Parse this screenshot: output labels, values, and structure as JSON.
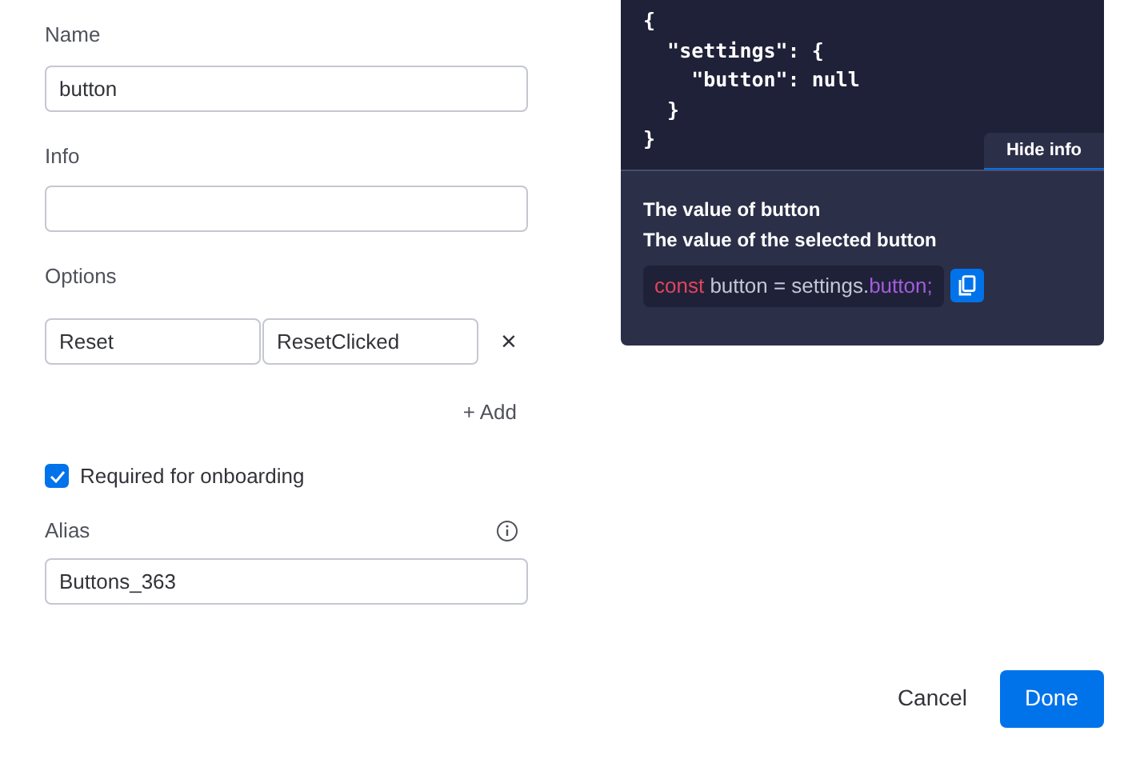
{
  "form": {
    "name": {
      "label": "Name",
      "value": "button"
    },
    "info": {
      "label": "Info"
    },
    "options": {
      "label": "Options",
      "rows": [
        {
          "label": "Reset",
          "value": "ResetClicked",
          "remove": "×"
        }
      ],
      "add": "+ Add"
    },
    "required": {
      "label": "Required for onboarding",
      "checked": true
    },
    "alias": {
      "label": "Alias",
      "value": "Buttons_363"
    }
  },
  "info_panel": {
    "code_lines": [
      "{",
      "  \"settings\": {",
      "    \"button\": null",
      "  }",
      "}"
    ],
    "toggle": "Hide info",
    "title": "The value of button",
    "description": "The value of the selected button",
    "snippet": [
      {
        "kind": "keyword",
        "text": "const"
      },
      {
        "kind": "plain",
        "text": " button = settings."
      },
      {
        "kind": "member",
        "text": "button;"
      }
    ]
  },
  "footer": {
    "cancel": "Cancel",
    "done": "Done"
  }
}
